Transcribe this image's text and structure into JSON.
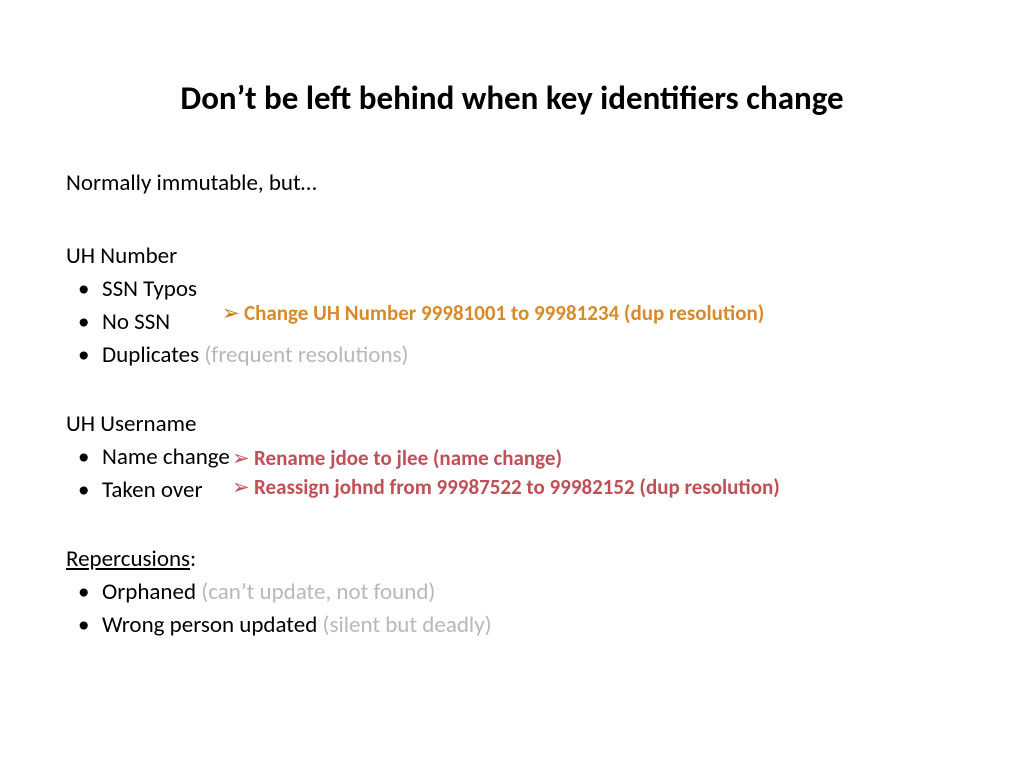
{
  "title": "Don’t be left behind when key identifiers change",
  "intro": "Normally immutable, but…",
  "section1": {
    "head": "UH Number",
    "b1": "SSN Typos",
    "b2": "No SSN",
    "b3": "Duplicates",
    "b3_muted": " (frequent resolutions)"
  },
  "callout1": "Change UH Number 99981001 to 99981234 (dup resolution)",
  "section2": {
    "head": "UH Username",
    "b1": "Name change",
    "b2": "Taken over"
  },
  "callout2": "Rename jdoe to jlee (name change)",
  "callout3": "Reassign johnd from 99987522 to 99982152 (dup resolution)",
  "section3": {
    "head": "Repercusions",
    "head_tail": ":",
    "b1": "Orphaned",
    "b1_muted": " (can’t update, not found)",
    "b2": "Wrong person updated",
    "b2_muted": " (silent but deadly)"
  },
  "glyphs": {
    "arrow": "➢"
  }
}
